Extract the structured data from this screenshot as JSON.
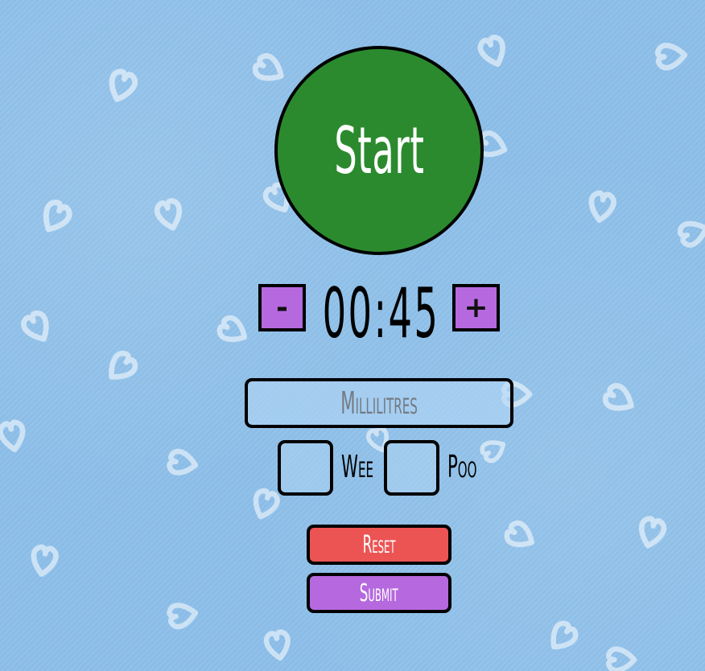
{
  "start_button": {
    "label": "Start",
    "color": "#2b8a2e"
  },
  "timer": {
    "minus_label": "-",
    "value": "00:45",
    "plus_label": "+",
    "stepper_color": "#b669df"
  },
  "millilitres": {
    "placeholder": "Millilitres",
    "value": ""
  },
  "checkboxes": {
    "wee_label": "Wee",
    "poo_label": "Poo"
  },
  "actions": {
    "reset_label": "Reset",
    "reset_color": "#ec5454",
    "submit_label": "Submit",
    "submit_color": "#b669df"
  },
  "background": {
    "color": "#8ec0ea",
    "pattern": "heart-icon"
  }
}
